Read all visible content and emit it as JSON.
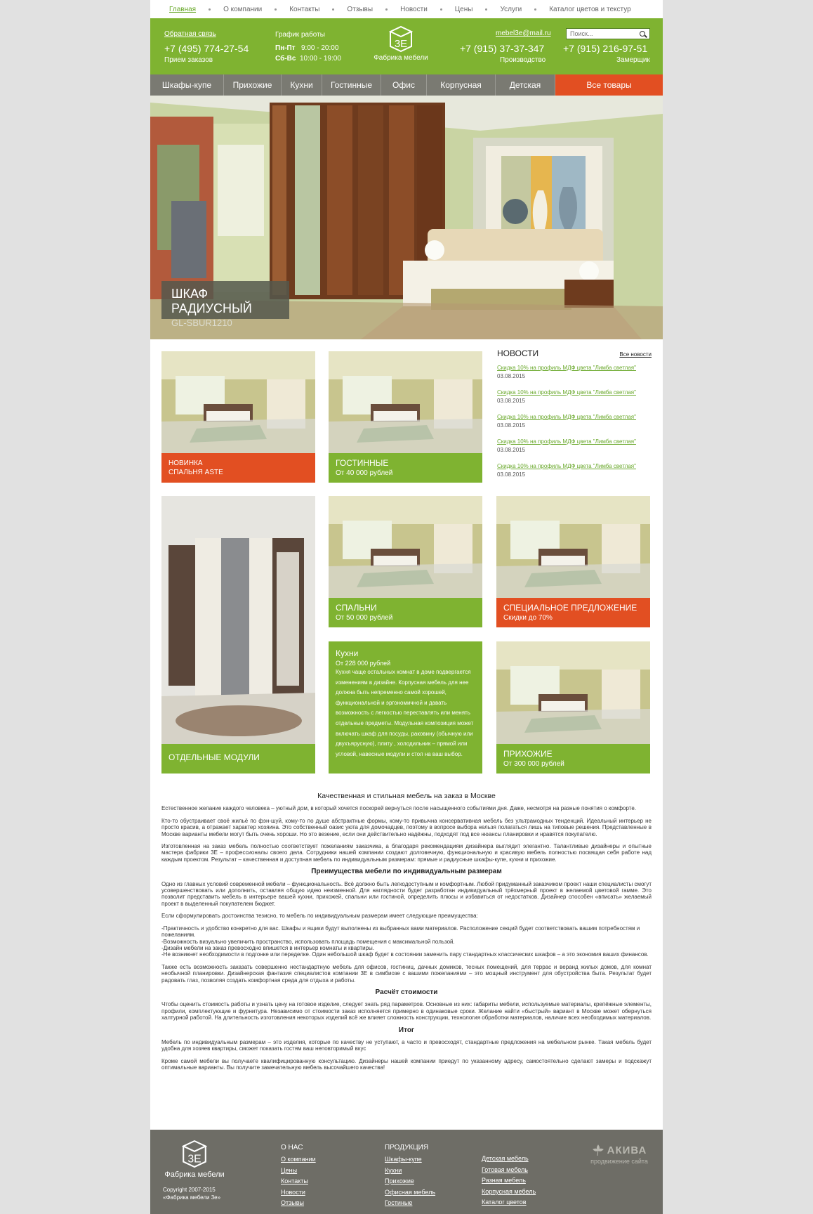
{
  "topnav": {
    "items": [
      "Главная",
      "О компании",
      "Контакты",
      "Отзывы",
      "Новости",
      "Цены",
      "Услуги",
      "Каталог цветов и текстур"
    ]
  },
  "header": {
    "feedback": "Обратная связь",
    "phone1": "+7 (495) 774-27-54",
    "phone1_note": "Прием заказов",
    "schedule_title": "График работы",
    "weekdays": "Пн-Пт",
    "weekdays_hours": "9:00 - 20:00",
    "weekend": "Сб-Вс",
    "weekend_hours": "10:00 - 19:00",
    "logo_mark": "3Е",
    "logo_name": "Фабрика мебели",
    "email": "mebel3e@mail.ru",
    "phone2": "+7 (915) 37-37-347",
    "phone2_note": "Производство",
    "search_placeholder": "Поиск...",
    "phone3": "+7 (915) 216-97-51",
    "phone3_note": "Замерщик"
  },
  "menu": {
    "items": [
      "Шкафы-купе",
      "Прихожие",
      "Кухни",
      "Гостинные",
      "Офис",
      "Корпусная",
      "Детская",
      "Все товары"
    ]
  },
  "hero": {
    "title": "ШКАФ РАДИУСНЫЙ",
    "subtitle": "GL-SBUR1210"
  },
  "tiles": {
    "t1": {
      "title": "Новинка",
      "sub": "СПАЛЬНЯ ASTE"
    },
    "t2": {
      "title": "Гостинные",
      "sub": "От 40 000 рублей"
    },
    "t3": {
      "title": "Отдельные модули"
    },
    "t4": {
      "title": "Спальни",
      "sub": "От 50 000 рублей"
    },
    "t5": {
      "title": "Специальное предложение",
      "sub": "Скидки до 70%"
    },
    "t6": {
      "title": "Кухни",
      "sub": "От 228 000 рублей",
      "text": "Кухня чаще остальных комнат в доме подвергается изменениям в дизайне. Корпусная мебель для нее должна быть непременно самой хорошей, функциональной и эргономичной и давать возможность с легкостью переставлять или менять отдельные предметы. Модульная композиция может включать шкаф для посуды, раковину (обычную или двухъярусную), плиту , холодильник – прямой или угловой, навесные модули и стол на ваш выбор."
    },
    "t7": {
      "title": "Прихожие",
      "sub": "От 300 000 рублей"
    }
  },
  "news": {
    "title": "НОВОСТИ",
    "all_link": "Все новости",
    "items": [
      {
        "text": "Скидка 10% на профиль МДФ цвета \"Лимба светлая\"",
        "date": "03.08.2015"
      },
      {
        "text": "Скидка 10% на профиль МДФ цвета \"Лимба светлая\"",
        "date": "03.08.2015"
      },
      {
        "text": "Скидка 10% на профиль МДФ цвета \"Лимба светлая\"",
        "date": "03.08.2015"
      },
      {
        "text": "Скидка 10% на профиль МДФ цвета \"Лимба светлая\"",
        "date": "03.08.2015"
      },
      {
        "text": "Скидка 10% на профиль МДФ цвета \"Лимба светлая\"",
        "date": "03.08.2015"
      }
    ]
  },
  "article": {
    "h1": "Качественная и стильная мебель на заказ в Москве",
    "p1": "Естественное желание каждого человека – уютный дом, в который хочется поскорей вернуться после насыщенного событиями дня. Даже, несмотря на разные понятия о комфорте.",
    "p2": "Кто-то обустраивает своё жильё по фэн-шуй, кому-то по душе абстрактные формы, кому-то привычна консервативная мебель без ультрамодных тенденций. Идеальный интерьер не просто красив, а отражает характер хозяина. Это собственный оазис уюта для домочадцев, поэтому в вопросе выбора нельзя полагаться лишь на типовые решения. Представленные в Москве варианты мебели могут быть очень хороши. Но это везение, если они действительно надёжны, подходят под все нюансы планировки и нравятся покупателю.",
    "p3": "Изготовленная на заказ мебель полностью соответствует пожеланиям заказчика, а благодаря рекомендациям дизайнера выглядит элегантно. Талантливые дизайнеры и опытные мастера фабрики 3Е – профессионалы своего дела. Сотрудники нашей компании создают долговечную, функциональную и красивую мебель полностью посвящая себя работе над каждым проектом. Результат – качественная и доступная мебель по индивидуальным размерам: прямые и радиусные шкафы-купе, кухни и прихожие.",
    "h2": "Преимущества мебели по индивидуальным размерам",
    "p4": "Одно из главных условий современной мебели – функциональность. Всё должно быть легкодоступным и комфортным. Любой придуманный заказчиком проект наши специалисты смогут усовершенствовать или дополнить, оставляя общую идею неизменной. Для наглядности будет разработан индивидуальный трёхмерный проект в желаемой цветовой гамме. Это позволит представить мебель в интерьере вашей кухни, прихожей, спальни или гостиной, определить плюсы и избавиться от недостатков. Дизайнер способен «вписать» желаемый проект в выделенный покупателем бюджет.",
    "p5": "Если сформулировать достоинства тезисно, то мебель по индивидуальным размерам имеет следующие преимущества:",
    "list": [
      "-Практичность и удобство конкретно для вас. Шкафы и ящики будут выполнены из выбранных вами материалов. Расположение секций будет соответствовать вашим потребностям и пожеланиям.",
      "-Возможность визуально увеличить пространство, использовать площадь помещения с максимальной пользой.",
      "-Дизайн мебели на заказ превосходно впишется в интерьер комнаты и квартиры.",
      "-Не возникнет необходимости в подгонке или переделке. Один небольшой шкаф будет в состоянии заменить пару стандартных классических шкафов – а это экономия ваших финансов."
    ],
    "p6": "Также есть возможность заказать совершенно нестандартную мебель для офисов, гостиниц, дачных домиков, тесных помещений, для террас и веранд жилых домов, для комнат необычной планировки. Дизайнерская фантазия специалистов компании 3Е в симбиозе с вашими пожеланиями – это мощный инструмент для обустройства быта. Результат будет радовать глаз, позволяя создать комфортная среда для отдыха и работы.",
    "h3": "Расчёт стоимости",
    "p7": "Чтобы оценить стоимость работы и узнать цену на готовое изделие, следует знать ряд параметров. Основные из них: габариты мебели, используемые материалы, крепёжные элементы, профили, комплектующие и фурнитура. Независимо от стоимости заказ исполняется примерно в одинаковые сроки. Желание найти «быстрый» вариант в Москве может обернуться халтурной работой. На длительность изготовления некоторых изделий всё же влияет сложность конструкции, технология обработки материалов, наличие всех необходимых материалов.",
    "h4": "Итог",
    "p8": "Мебель по индивидуальным размерам – это изделия, которые по качеству не уступают, а часто и превосходят, стандартные предложения на мебельном рынке. Такая мебель будет удобна для хозяев квартиры, сможет показать гостям ваш неповторимый вкус",
    "p9": "Кроме самой мебели вы получаете квалифицированную консультацию. Дизайнеры нашей компании приедут по указанному адресу, самостоятельно сделают замеры и подскажут оптимальные варианты. Вы получите замечательную мебель высочайшего качества!"
  },
  "footer": {
    "logo_name": "Фабрика мебели",
    "copyright1": "Copyright 2007-2015",
    "copyright2": "«Фабрика мебели 3е»",
    "about_title": "О НАС",
    "about_links": [
      "О компании",
      "Цены",
      "Контакты",
      "Новости",
      "Отзывы"
    ],
    "products_title": "ПРОДУКЦИЯ",
    "products_links1": [
      "Шкафы-купе",
      "Кухни",
      "Прихожие",
      "Офисная мебель",
      "Гостиные"
    ],
    "products_links2": [
      "Детская мебель",
      "Готовая мебель",
      "Разная мебель",
      "Корпусная мебель",
      "Каталог цветов"
    ],
    "agency_name": "АКИВА",
    "agency_note": "продвижение сайта"
  },
  "colors": {
    "green": "#7fb331",
    "orange": "#e24f22",
    "menu_gray": "#7a7a72",
    "footer_gray": "#6e6d66",
    "background": "#e1e1e1"
  }
}
